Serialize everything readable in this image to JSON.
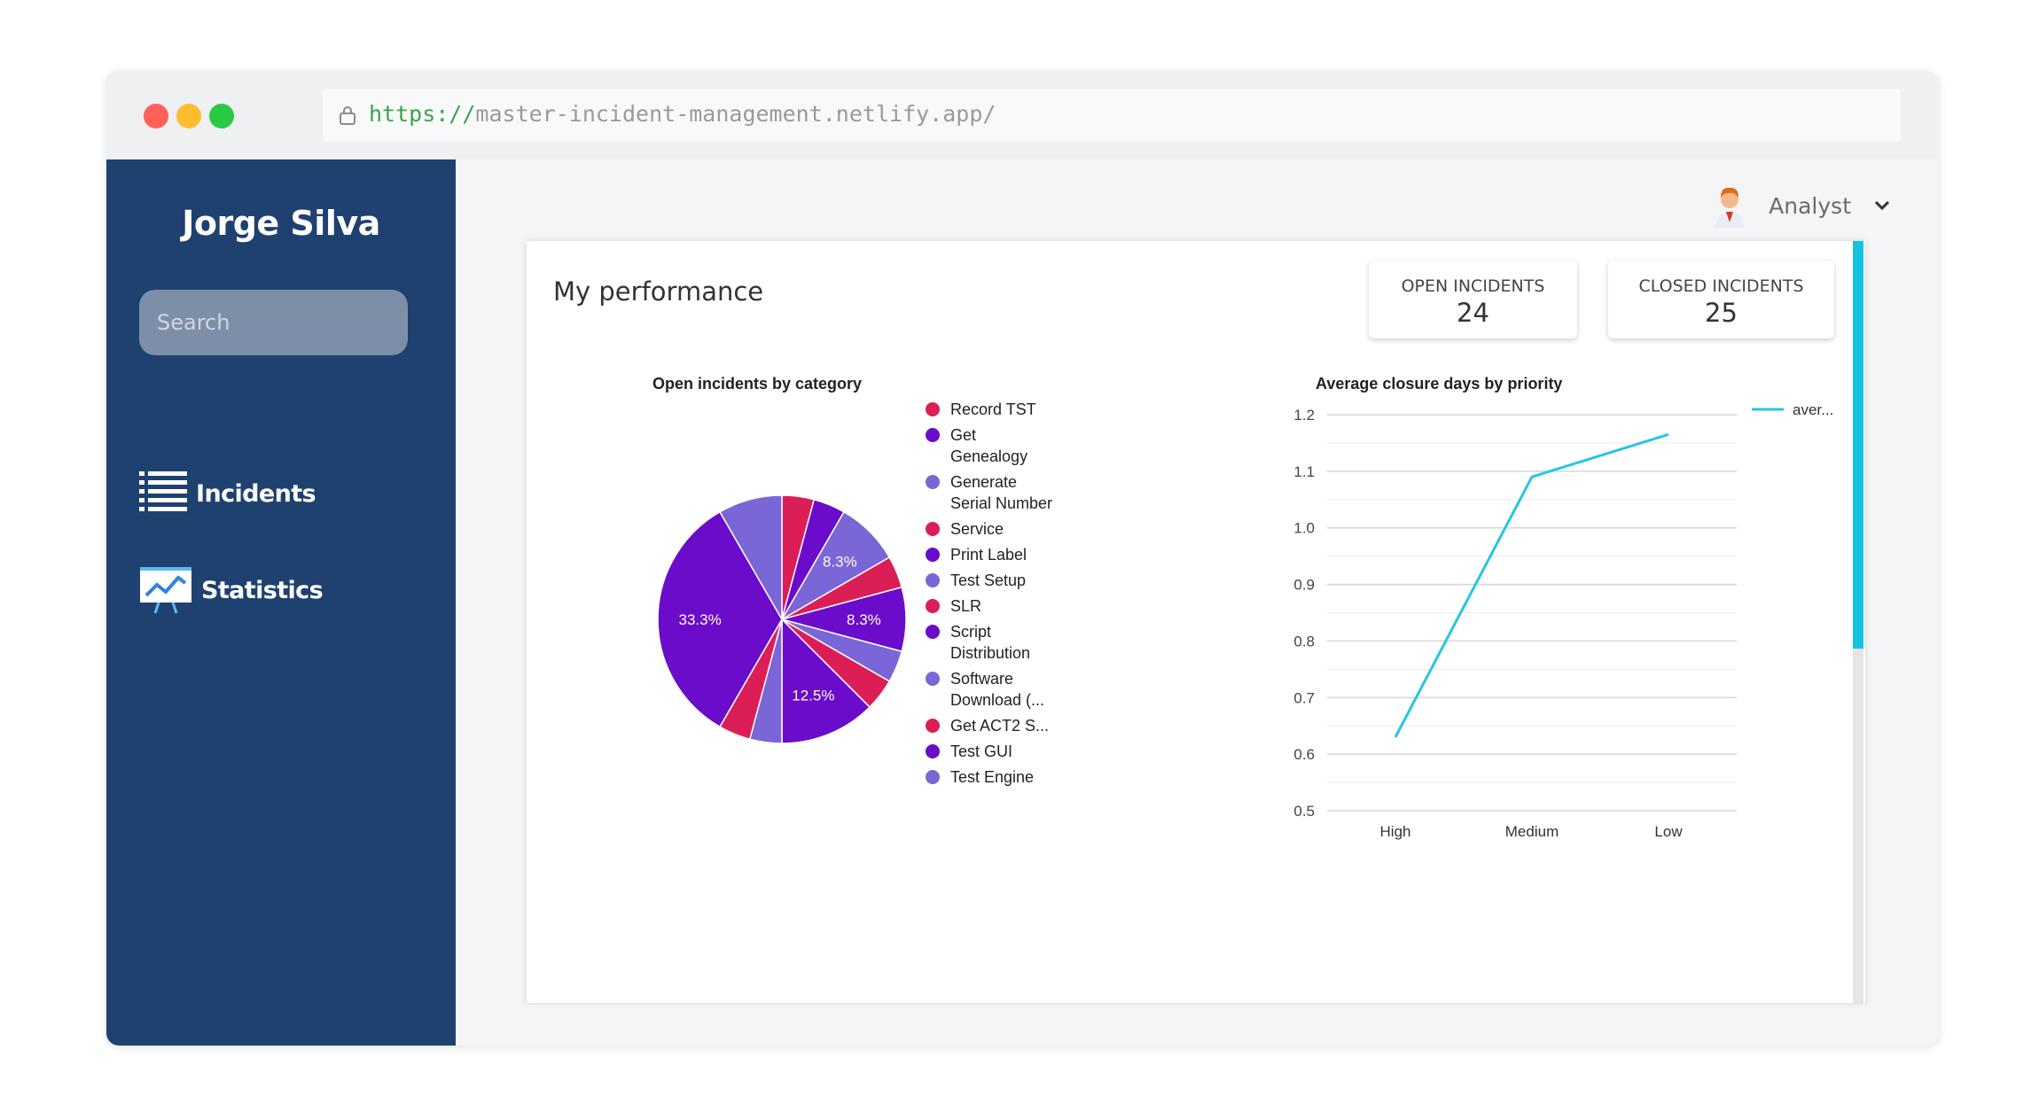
{
  "browser": {
    "url_scheme": "https://",
    "url_rest": "master-incident-management.netlify.app/"
  },
  "sidebar": {
    "user_name": "Jorge Silva",
    "search_placeholder": "Search",
    "items": [
      {
        "label": "Incidents",
        "icon": "list-icon"
      },
      {
        "label": "Statistics",
        "icon": "chart-icon"
      }
    ]
  },
  "header": {
    "role": "Analyst",
    "avatar_icon": "user-avatar-icon"
  },
  "performance": {
    "title": "My performance",
    "open_label": "OPEN INCIDENTS",
    "open_value": "24",
    "closed_label": "CLOSED INCIDENTS",
    "closed_value": "25"
  },
  "chart_data": [
    {
      "type": "pie",
      "title": "Open incidents by category",
      "slices": [
        {
          "label": "Record TST",
          "value": 1,
          "color": "#dc1e56"
        },
        {
          "label": "Get Genealogy",
          "value": 1,
          "color": "#6a0cc9"
        },
        {
          "label": "Generate Serial Number",
          "value": 2,
          "color": "#7a66d6"
        },
        {
          "label": "Service",
          "value": 1,
          "color": "#dc1e56"
        },
        {
          "label": "Print Label",
          "value": 2,
          "color": "#6a0cc9"
        },
        {
          "label": "Test Setup",
          "value": 1,
          "color": "#7a66d6"
        },
        {
          "label": "SLR",
          "value": 1,
          "color": "#dc1e56"
        },
        {
          "label": "Script Distribution",
          "value": 3,
          "color": "#6a0cc9"
        },
        {
          "label": "Software Download (...",
          "value": 1,
          "color": "#7a66d6"
        },
        {
          "label": "Get ACT2 S...",
          "value": 1,
          "color": "#dc1e56"
        },
        {
          "label": "Test GUI",
          "value": 8,
          "color": "#6a0cc9"
        },
        {
          "label": "Test Engine",
          "value": 2,
          "color": "#7a66d6"
        }
      ],
      "slice_labels": [
        "8.3%",
        "8.3%",
        "12.5%",
        "33.3%"
      ]
    },
    {
      "type": "line",
      "title": "Average closure days by priority",
      "categories": [
        "High",
        "Medium",
        "Low"
      ],
      "series": [
        {
          "name": "aver...",
          "values": [
            0.63,
            1.09,
            1.165
          ],
          "color": "#26c6e0"
        }
      ],
      "ylim": [
        0.5,
        1.2
      ],
      "yticks": [
        "1.2",
        "1.1",
        "1.0",
        "0.9",
        "0.8",
        "0.7",
        "0.6",
        "0.5"
      ],
      "grid": true,
      "legend_position": "right"
    }
  ]
}
